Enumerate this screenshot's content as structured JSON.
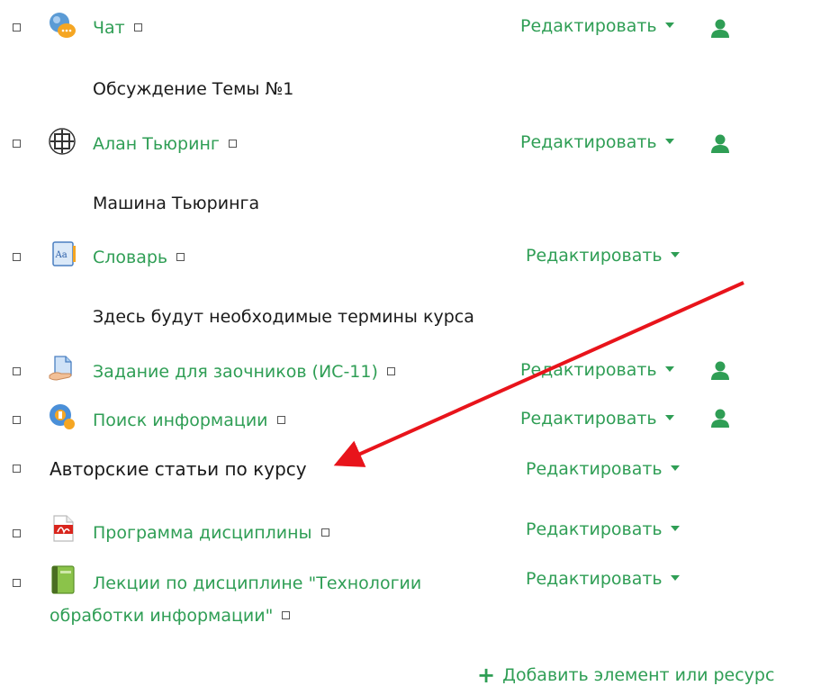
{
  "colors": {
    "link": "#2f9e55",
    "text": "#1a1a1a",
    "arrow": "#e8141b"
  },
  "edit_label": "Редактировать",
  "items": [
    {
      "title": "Чат",
      "icon": "chat-icon",
      "description": "Обсуждение Темы №1",
      "has_group_icon": true
    },
    {
      "title": "Алан Тьюринг",
      "icon": "turing-portrait-icon",
      "description": "Машина Тьюринга",
      "has_group_icon": true
    },
    {
      "title": "Словарь",
      "icon": "glossary-icon",
      "description": "Здесь будут необходимые термины курса",
      "has_group_icon": false
    },
    {
      "title": "Задание для заочников (ИС-11)",
      "icon": "assignment-icon",
      "has_group_icon": true
    },
    {
      "title": "Поиск информации",
      "icon": "search-info-icon",
      "has_group_icon": true
    },
    {
      "title": "Авторские статьи по курсу",
      "icon": "",
      "is_label": true,
      "has_group_icon": false
    },
    {
      "title": "Программа дисциплины",
      "icon": "pdf-icon",
      "has_group_icon": false
    },
    {
      "title_line1": "Лекции по дисциплине \"Технологии",
      "title_line2": "обработки информации\"",
      "icon": "book-icon",
      "has_group_icon": false
    }
  ],
  "add_activity_label": "Добавить элемент или ресурс"
}
